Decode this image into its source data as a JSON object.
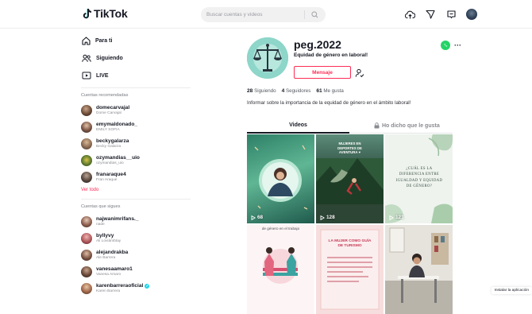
{
  "header": {
    "logo_text": "TikTok",
    "search_placeholder": "Buscar cuentas y videos"
  },
  "sidebar": {
    "nav": [
      {
        "label": "Para ti",
        "icon": "home-icon"
      },
      {
        "label": "Siguiendo",
        "icon": "following-icon"
      },
      {
        "label": "LIVE",
        "icon": "live-icon"
      }
    ],
    "suggested_title": "Cuentas recomendadas",
    "suggested": [
      {
        "name": "domecarvajal",
        "sub": "Dome Carvajal"
      },
      {
        "name": "emymaldonado_",
        "sub": "EMILY SOFIA"
      },
      {
        "name": "beckygalarza",
        "sub": "Becky Galarza"
      },
      {
        "name": "ozymandias__uio",
        "sub": "ozymandias_uio"
      },
      {
        "name": "franaraque4",
        "sub": "Fran Araque"
      }
    ],
    "see_all": "Ver todo",
    "following_title": "Cuentas que sigues",
    "following": [
      {
        "name": "najwanimrifans._",
        "sub": "nade",
        "verified": false
      },
      {
        "name": "byllyvy",
        "sub": "Ali Loviámbtay",
        "verified": false
      },
      {
        "name": "alejandrakba",
        "sub": "Ale Barrera",
        "verified": false
      },
      {
        "name": "vanesaamaro1",
        "sub": "Vanesa Amaro",
        "verified": false
      },
      {
        "name": "karenbarreraoficial",
        "sub": "Karen Barrera",
        "verified": true
      }
    ]
  },
  "profile": {
    "username": "peg.2022",
    "nickname": "Equidad de género en laboral!",
    "message_label": "Mensaje",
    "stats": [
      {
        "value": "28",
        "label": "Siguiendo"
      },
      {
        "value": "4",
        "label": "Seguidores"
      },
      {
        "value": "61",
        "label": "Me gusta"
      }
    ],
    "bio": "Informar sobre la importancia de la equidad de género en el ámbito laboral!"
  },
  "tabs": {
    "videos": "Videos",
    "liked": "Ho dicho que le gusta"
  },
  "videos": [
    {
      "views": "68"
    },
    {
      "views": "128",
      "caption": "MUJERES EN DEPORTES DE AVENTURA ♥"
    },
    {
      "views": "121",
      "caption": "¿CUÁL ES LA DIFERENCIA ENTRE IGUALDAD Y EQUIDAD DE GÉNERO?"
    },
    {
      "caption": "de género en el trabajo"
    },
    {
      "caption": "LA MUJER COMO GUÍA DE TURISMO"
    },
    {}
  ],
  "install_label": "Instalar la aplicación",
  "colors": {
    "accent": "#fe2c55",
    "whatsapp": "#25d366",
    "verified": "#20d5ec"
  }
}
